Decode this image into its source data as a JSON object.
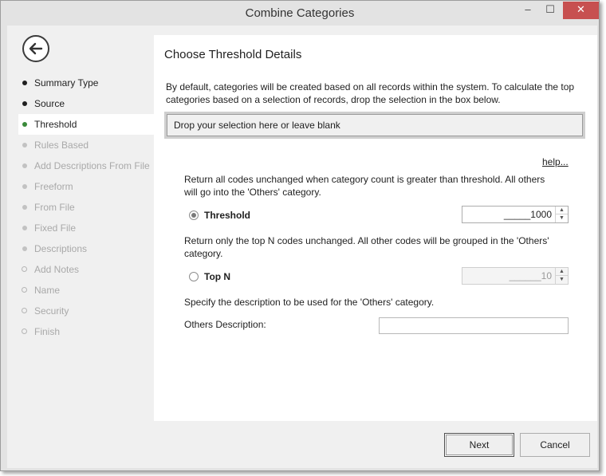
{
  "window": {
    "title": "Combine Categories",
    "controls": {
      "minimize": "‒",
      "maximize": "☐",
      "close": "✕"
    }
  },
  "sidebar": {
    "back_icon": "back-arrow-icon",
    "items": [
      {
        "label": "Summary Type",
        "state": "done"
      },
      {
        "label": "Source",
        "state": "done"
      },
      {
        "label": "Threshold",
        "state": "current"
      },
      {
        "label": "Rules Based",
        "state": "disabled"
      },
      {
        "label": "Add Descriptions From File",
        "state": "disabled"
      },
      {
        "label": "Freeform",
        "state": "disabled"
      },
      {
        "label": "From File",
        "state": "disabled"
      },
      {
        "label": "Fixed File",
        "state": "disabled"
      },
      {
        "label": "Descriptions",
        "state": "disabled"
      },
      {
        "label": "Add Notes",
        "state": "optional"
      },
      {
        "label": "Name",
        "state": "optional"
      },
      {
        "label": "Security",
        "state": "optional"
      },
      {
        "label": "Finish",
        "state": "optional"
      }
    ]
  },
  "content": {
    "heading": "Choose Threshold Details",
    "intro": "By default, categories will be created based on all records within the system. To calculate the top categories based on a selection of records, drop the selection in the box below.",
    "dropzone_text": "Drop your selection here or leave blank",
    "help_link": "help...",
    "threshold": {
      "description": "Return all codes unchanged when category count is greater than threshold. All others will go into the 'Others' category.",
      "label": "Threshold",
      "selected": true,
      "value": "_____1000"
    },
    "top_n": {
      "description": "Return only the top N codes unchanged. All other codes will be grouped in the 'Others' category.",
      "label": "Top N",
      "selected": false,
      "value": "______10"
    },
    "others": {
      "description": "Specify the description to be used for the 'Others' category.",
      "label": "Others Description:",
      "value": ""
    }
  },
  "footer": {
    "next_label": "Next",
    "cancel_label": "Cancel"
  }
}
